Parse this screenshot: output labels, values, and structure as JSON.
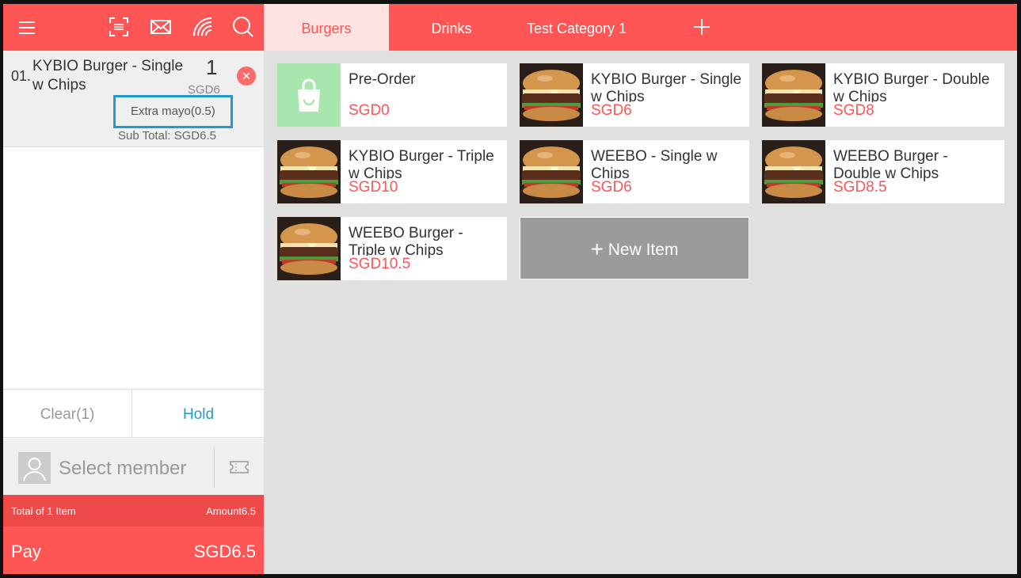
{
  "header_icons": [
    "menu-icon",
    "scan-icon",
    "mail-icon",
    "nfc-icon",
    "search-icon"
  ],
  "order": {
    "index": "01.",
    "name": "KYBIO Burger - Single w Chips",
    "qty": "1",
    "price": "SGD6",
    "modifier": "Extra mayo(0.5)",
    "subtotal": "Sub Total: SGD6.5"
  },
  "actions": {
    "clear": "Clear(1)",
    "hold": "Hold"
  },
  "member": {
    "placeholder": "Select member"
  },
  "totals": {
    "items": "Total of 1 Item",
    "amount": "Amount6.5"
  },
  "pay": {
    "label": "Pay",
    "amount": "SGD6.5"
  },
  "tabs": [
    {
      "label": "Burgers",
      "active": true
    },
    {
      "label": "Drinks",
      "active": false
    },
    {
      "label": "Test Category 1",
      "active": false
    }
  ],
  "products": [
    {
      "name": "Pre-Order",
      "price": "SGD0",
      "image": "shopping-bag-icon"
    },
    {
      "name": "KYBIO Burger - Single w Chips",
      "price": "SGD6",
      "image": "burger-photo"
    },
    {
      "name": "KYBIO Burger - Double w Chips",
      "price": "SGD8",
      "image": "burger-photo"
    },
    {
      "name": "KYBIO Burger - Triple w Chips",
      "price": "SGD10",
      "image": "burger-photo"
    },
    {
      "name": "WEEBO - Single w Chips",
      "price": "SGD6",
      "image": "burger-photo"
    },
    {
      "name": "WEEBO Burger - Double w Chips",
      "price": "SGD8.5",
      "image": "burger-photo"
    },
    {
      "name": "WEEBO Burger - Triple w Chips",
      "price": "SGD10.5",
      "image": "burger-photo"
    }
  ],
  "new_item": {
    "label": "New Item"
  },
  "colors": {
    "brand": "#ff5555",
    "accent": "#1e9ad6",
    "price": "#ff5555"
  }
}
